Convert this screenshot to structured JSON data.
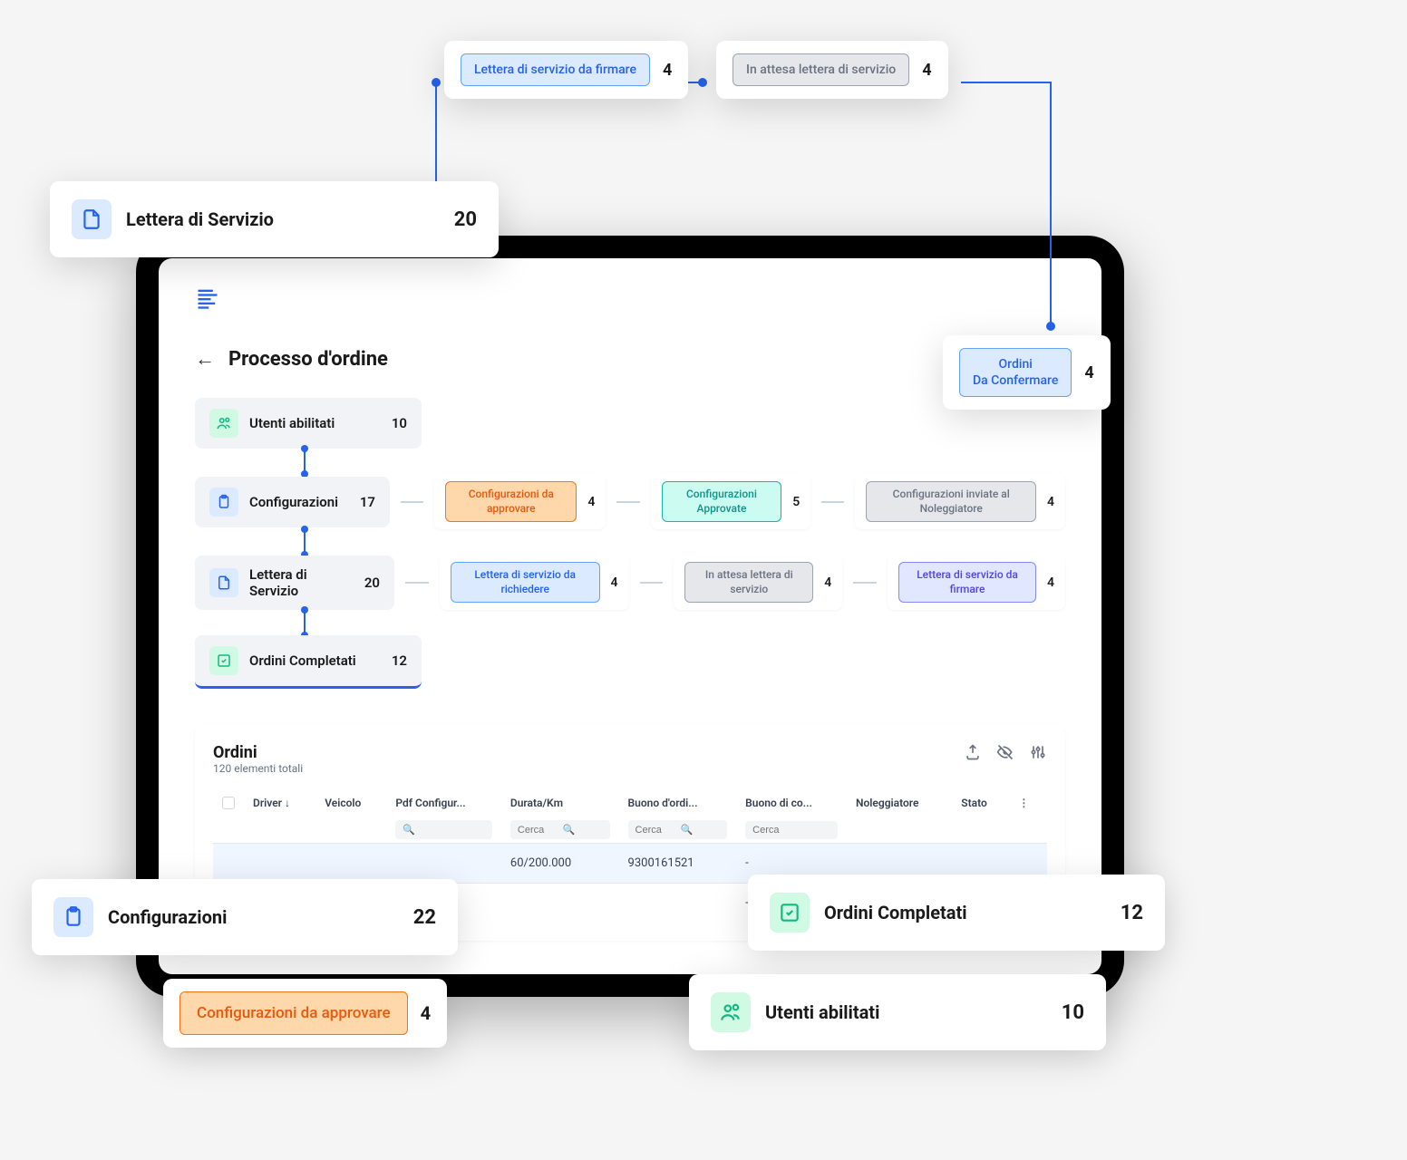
{
  "page": {
    "title": "Processo d'ordine"
  },
  "process": [
    {
      "label": "Utenti abilitati",
      "count": "10",
      "icon": "green-users",
      "sub": []
    },
    {
      "label": "Configurazioni",
      "count": "17",
      "icon": "blue-clipboard",
      "sub": [
        {
          "label": "Configurazioni da approvare",
          "count": "4",
          "color": "orange"
        },
        {
          "label": "Configurazioni Approvate",
          "count": "5",
          "color": "teal"
        },
        {
          "label": "Configurazioni inviate al Noleggiatore",
          "count": "4",
          "color": "gray"
        }
      ]
    },
    {
      "label": "Lettera di Servizio",
      "count": "20",
      "icon": "blue-file",
      "sub": [
        {
          "label": "Lettera di servizio da richiedere",
          "count": "4",
          "color": "blue"
        },
        {
          "label": "In attesa lettera di servizio",
          "count": "4",
          "color": "gray"
        },
        {
          "label": "Lettera di servizio da firmare",
          "count": "4",
          "color": "purple"
        }
      ]
    },
    {
      "label": "Ordini Completati",
      "count": "12",
      "icon": "green-check",
      "sub": [],
      "selected": true
    }
  ],
  "table": {
    "title": "Ordini",
    "subtitle": "120 elementi totali",
    "columns": [
      "Driver",
      "Veicolo",
      "Pdf Configur...",
      "Durata/Km",
      "Buono d'ordi...",
      "Buono di co...",
      "Noleggiatore",
      "Stato"
    ],
    "filter_placeholder": "Cerca",
    "rows": [
      {
        "durata": "60/200.000",
        "buono": "9300161521",
        "consegna": "-"
      },
      {
        "consegna": "-"
      }
    ]
  },
  "floats": {
    "lettera_servizio": {
      "label": "Lettera di Servizio",
      "count": "20"
    },
    "lettera_firmare": {
      "label": "Lettera di servizio da firmare",
      "count": "4"
    },
    "attesa_lettera": {
      "label": "In attesa lettera di servizio",
      "count": "4"
    },
    "ordini_confermare": {
      "label": "Ordini\nDa Confermare",
      "count": "4"
    },
    "configurazioni": {
      "label": "Configurazioni",
      "count": "22"
    },
    "config_approvare": {
      "label": "Configurazioni da approvare",
      "count": "4"
    },
    "ordini_completati": {
      "label": "Ordini Completati",
      "count": "12"
    },
    "utenti_abilitati": {
      "label": "Utenti abilitati",
      "count": "10"
    }
  }
}
